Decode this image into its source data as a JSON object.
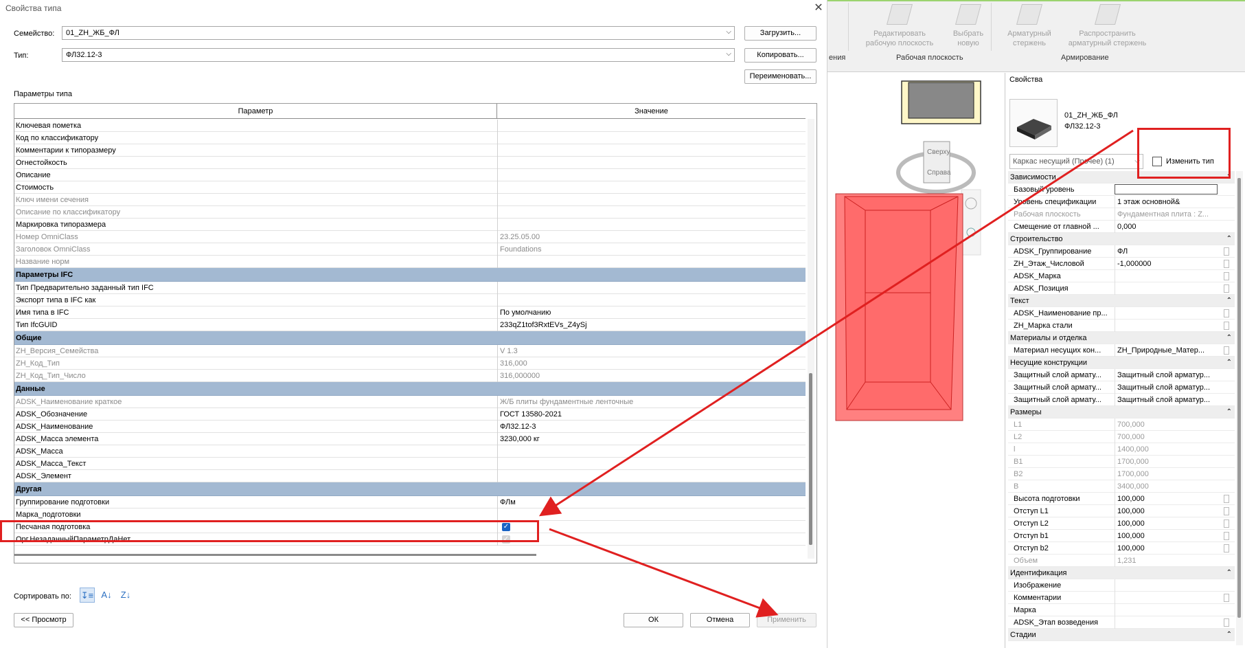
{
  "dialog": {
    "title": "Свойства типа",
    "family_label": "Семейство:",
    "family_value": "01_ZH_ЖБ_ФЛ",
    "type_label": "Тип:",
    "type_value": "ФЛ32.12-3",
    "load_button": "Загрузить...",
    "copy_button": "Копировать...",
    "rename_button": "Переименовать...",
    "params_heading": "Параметры типа",
    "col_param": "Параметр",
    "col_value": "Значение",
    "sort_label": "Сортировать по:",
    "preview_button": "<< Просмотр",
    "ok_button": "ОК",
    "cancel_button": "Отмена",
    "apply_button": "Применить"
  },
  "grid_rows": [
    {
      "name": "Ключевая пометка",
      "value": "",
      "kind": "row"
    },
    {
      "name": "Код по классификатору",
      "value": "",
      "kind": "row"
    },
    {
      "name": "Комментарии к типоразмеру",
      "value": "",
      "kind": "row"
    },
    {
      "name": "Огнестойкость",
      "value": "",
      "kind": "row"
    },
    {
      "name": "Описание",
      "value": "",
      "kind": "row"
    },
    {
      "name": "Стоимость",
      "value": "",
      "kind": "row"
    },
    {
      "name": "Ключ имени сечения",
      "value": "",
      "kind": "gray"
    },
    {
      "name": "Описание по классификатору",
      "value": "",
      "kind": "gray"
    },
    {
      "name": "Маркировка типоразмера",
      "value": "",
      "kind": "row"
    },
    {
      "name": "Номер OmniClass",
      "value": "23.25.05.00",
      "kind": "gray"
    },
    {
      "name": "Заголовок OmniClass",
      "value": "Foundations",
      "kind": "gray"
    },
    {
      "name": "Название норм",
      "value": "",
      "kind": "gray"
    },
    {
      "name": "Параметры IFC",
      "value": "",
      "kind": "group"
    },
    {
      "name": "Тип Предварительно заданный тип IFC",
      "value": "",
      "kind": "row"
    },
    {
      "name": "Экспорт типа в IFC как",
      "value": "",
      "kind": "row"
    },
    {
      "name": "Имя типа в IFC",
      "value": "По умолчанию",
      "kind": "row"
    },
    {
      "name": "Тип IfcGUID",
      "value": "233qZ1tof3RxtEVs_Z4ySj",
      "kind": "row"
    },
    {
      "name": "Общие",
      "value": "",
      "kind": "group"
    },
    {
      "name": "ZH_Версия_Семейства",
      "value": "V 1.3",
      "kind": "gray"
    },
    {
      "name": "ZH_Код_Тип",
      "value": "316,000",
      "kind": "gray"
    },
    {
      "name": "ZH_Код_Тип_Число",
      "value": "316,000000",
      "kind": "gray"
    },
    {
      "name": "Данные",
      "value": "",
      "kind": "group"
    },
    {
      "name": "ADSK_Наименование краткое",
      "value": "Ж/Б плиты фундаментные ленточные",
      "kind": "gray"
    },
    {
      "name": "ADSK_Обозначение",
      "value": "ГОСТ 13580-2021",
      "kind": "row"
    },
    {
      "name": "ADSK_Наименование",
      "value": "ФЛ32.12-3",
      "kind": "row"
    },
    {
      "name": "ADSK_Масса элемента",
      "value": "3230,000 кг",
      "kind": "row"
    },
    {
      "name": "ADSK_Масса",
      "value": "",
      "kind": "row"
    },
    {
      "name": "ADSK_Масса_Текст",
      "value": "",
      "kind": "row"
    },
    {
      "name": "ADSK_Элемент",
      "value": "",
      "kind": "row"
    },
    {
      "name": "Другая",
      "value": "",
      "kind": "group"
    },
    {
      "name": "Группирование подготовки",
      "value": "ФЛм",
      "kind": "row"
    },
    {
      "name": "Марка_подготовки",
      "value": "",
      "kind": "row"
    },
    {
      "name": "Песчаная подготовка",
      "value": "",
      "kind": "check"
    },
    {
      "name": "Орг.НезаданныйПараметрДаНет",
      "value": "",
      "kind": "checkdim"
    }
  ],
  "ribbon": {
    "tool1": "Редактировать рабочую плоскость",
    "tool2": "Выбрать новую",
    "tool3": "Арматурный стержень",
    "tool4": "Распространить арматурный стержень",
    "panel0": "ения",
    "panel1": "Рабочая плоскость",
    "panel2": "Армирование"
  },
  "viewcube": {
    "top": "Сверху",
    "right": "Справа"
  },
  "properties": {
    "title": "Свойства",
    "type_line1": "01_ZH_ЖБ_ФЛ",
    "type_line2": "ФЛ32.12-3",
    "filter": "Каркас несущий (Прочее) (1)",
    "edit_type": "Изменить тип",
    "rows": [
      {
        "k": "Зависимости",
        "v": "",
        "kind": "grp"
      },
      {
        "k": "Базовый уровень",
        "v": "",
        "kind": "input"
      },
      {
        "k": "Уровень спецификации",
        "v": "1 этаж основной&",
        "kind": "row"
      },
      {
        "k": "Рабочая плоскость",
        "v": "Фундаментная плита : Z...",
        "kind": "gray"
      },
      {
        "k": "Смещение от главной ...",
        "v": "0,000",
        "kind": "row"
      },
      {
        "k": "Строительство",
        "v": "",
        "kind": "grp"
      },
      {
        "k": "ADSK_Группирование",
        "v": "ФЛ",
        "kind": "sq"
      },
      {
        "k": "ZH_Этаж_Числовой",
        "v": "-1,000000",
        "kind": "sq"
      },
      {
        "k": "ADSK_Марка",
        "v": "",
        "kind": "sq"
      },
      {
        "k": "ADSK_Позиция",
        "v": "",
        "kind": "sq"
      },
      {
        "k": "Текст",
        "v": "",
        "kind": "grp"
      },
      {
        "k": "ADSK_Наименование пр...",
        "v": "",
        "kind": "sq"
      },
      {
        "k": "ZH_Марка стали",
        "v": "",
        "kind": "sq"
      },
      {
        "k": "Материалы и отделка",
        "v": "",
        "kind": "grp"
      },
      {
        "k": "Материал несущих кон...",
        "v": "ZH_Природные_Матер...",
        "kind": "sq"
      },
      {
        "k": "Несущие конструкции",
        "v": "",
        "kind": "grp"
      },
      {
        "k": "Защитный слой армату...",
        "v": "Защитный слой арматур...",
        "kind": "row"
      },
      {
        "k": "Защитный слой армату...",
        "v": "Защитный слой арматур...",
        "kind": "row"
      },
      {
        "k": "Защитный слой армату...",
        "v": "Защитный слой арматур...",
        "kind": "row"
      },
      {
        "k": "Размеры",
        "v": "",
        "kind": "grp"
      },
      {
        "k": "L1",
        "v": "700,000",
        "kind": "gray"
      },
      {
        "k": "L2",
        "v": "700,000",
        "kind": "gray"
      },
      {
        "k": "l",
        "v": "1400,000",
        "kind": "gray"
      },
      {
        "k": "B1",
        "v": "1700,000",
        "kind": "gray"
      },
      {
        "k": "B2",
        "v": "1700,000",
        "kind": "gray"
      },
      {
        "k": "B",
        "v": "3400,000",
        "kind": "gray"
      },
      {
        "k": "Высота подготовки",
        "v": "100,000",
        "kind": "sq"
      },
      {
        "k": "Отступ L1",
        "v": "100,000",
        "kind": "sq"
      },
      {
        "k": "Отступ L2",
        "v": "100,000",
        "kind": "sq"
      },
      {
        "k": "Отступ b1",
        "v": "100,000",
        "kind": "sq"
      },
      {
        "k": "Отступ b2",
        "v": "100,000",
        "kind": "sq"
      },
      {
        "k": "Объем",
        "v": "1,231",
        "kind": "gray"
      },
      {
        "k": "Идентификация",
        "v": "",
        "kind": "grp"
      },
      {
        "k": "Изображение",
        "v": "",
        "kind": "row"
      },
      {
        "k": "Комментарии",
        "v": "",
        "kind": "sq"
      },
      {
        "k": "Марка",
        "v": "",
        "kind": "row"
      },
      {
        "k": "ADSK_Этап возведения",
        "v": "",
        "kind": "sq"
      },
      {
        "k": "Стадии",
        "v": "",
        "kind": "grp"
      }
    ]
  },
  "colors": {
    "accent": "#1a63c4",
    "group_row": "#a3b9d2",
    "annotation": "#e02020",
    "model_fill": "#ff6b6b"
  }
}
